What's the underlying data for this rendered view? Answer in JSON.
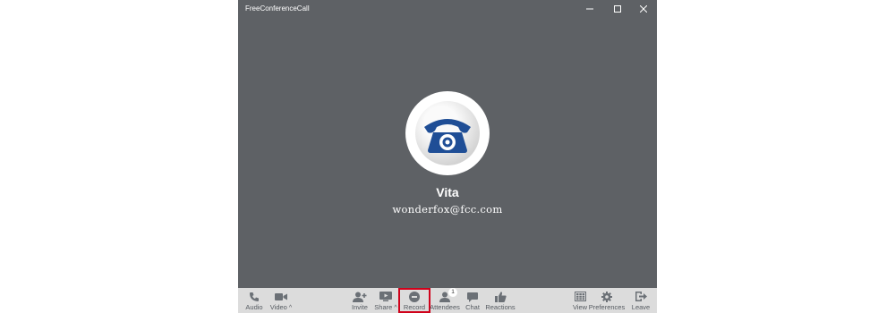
{
  "window": {
    "title": "FreeConferenceCall",
    "controls": {
      "minimize_icon": "minimize-icon",
      "maximize_icon": "maximize-icon",
      "close_icon": "close-icon"
    }
  },
  "stage": {
    "avatar_icon": "telephone-logo-icon",
    "user_name": "Vita",
    "user_email": "wonderfox@fcc.com"
  },
  "toolbar": {
    "audio": {
      "label": "Audio",
      "icon": "phone-icon"
    },
    "video": {
      "label": "Video",
      "icon": "video-camera-icon",
      "caret": "^"
    },
    "invite": {
      "label": "Invite",
      "icon": "add-user-icon"
    },
    "share": {
      "label": "Share",
      "icon": "share-screen-icon",
      "caret": "^"
    },
    "record": {
      "label": "Record",
      "icon": "record-icon"
    },
    "attendees": {
      "label": "Attendees",
      "icon": "person-icon",
      "count": "1"
    },
    "chat": {
      "label": "Chat",
      "icon": "chat-bubble-icon"
    },
    "reactions": {
      "label": "Reactions",
      "icon": "thumbs-up-icon"
    },
    "view": {
      "label": "View",
      "icon": "grid-view-icon"
    },
    "preferences": {
      "label": "Preferences",
      "icon": "gear-icon"
    },
    "leave": {
      "label": "Leave",
      "icon": "exit-icon"
    }
  },
  "colors": {
    "window_bg": "#5e6165",
    "toolbar_bg": "#dcdcdc",
    "icon_gray": "#6b7076",
    "record_highlight": "#d0021b",
    "logo_blue": "#1f4e96"
  }
}
